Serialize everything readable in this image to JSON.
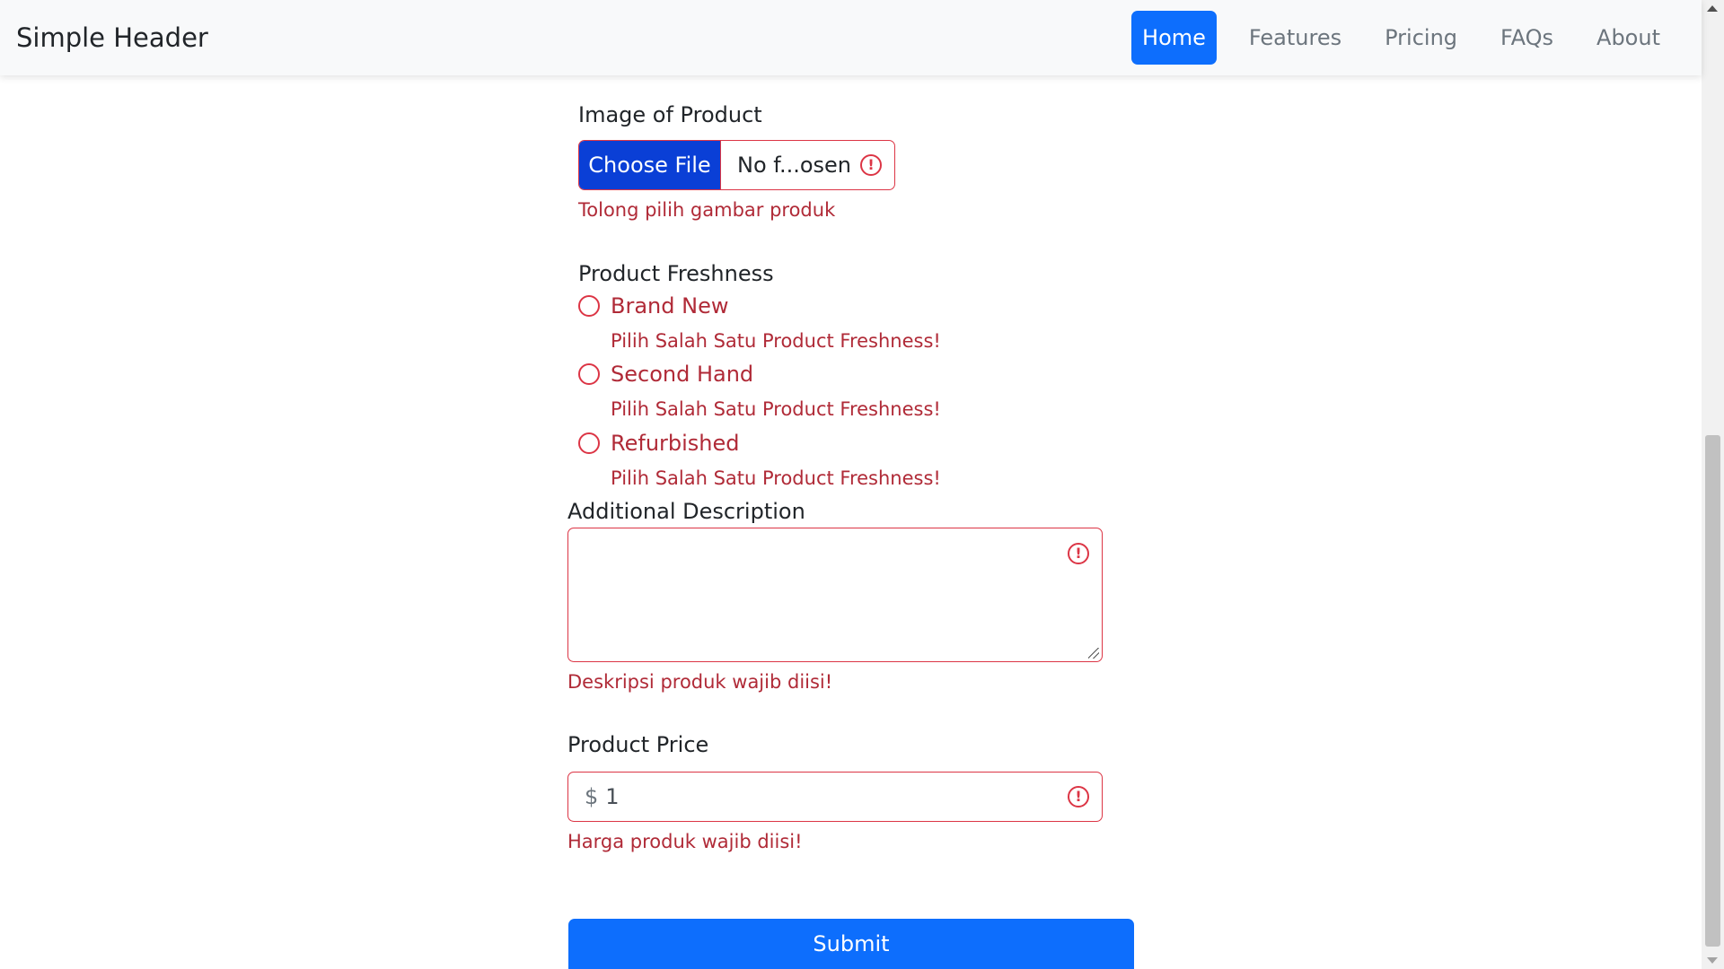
{
  "header": {
    "brand": "Simple Header",
    "nav": [
      "Home",
      "Features",
      "Pricing",
      "FAQs",
      "About"
    ],
    "active": "Home"
  },
  "form": {
    "image": {
      "label": "Image of Product",
      "button": "Choose File",
      "file_name": "No f...osen",
      "error": "Tolong pilih gambar produk"
    },
    "freshness": {
      "label": "Product Freshness",
      "options": [
        "Brand New",
        "Second Hand",
        "Refurbished"
      ],
      "error": "Pilih Salah Satu Product Freshness!"
    },
    "description": {
      "label": "Additional Description",
      "value": "",
      "error": "Deskripsi produk wajib diisi!"
    },
    "price": {
      "label": "Product Price",
      "prefix": "$",
      "value": "1",
      "error": "Harga produk wajib diisi!"
    },
    "submit": "Submit"
  },
  "colors": {
    "primary": "#0d6efd",
    "danger": "#dc3545",
    "danger_text": "#b02a37"
  }
}
